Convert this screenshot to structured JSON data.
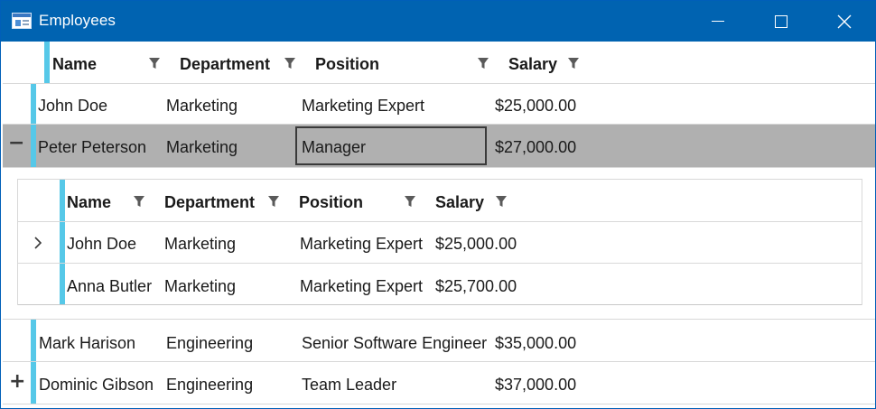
{
  "window": {
    "title": "Employees",
    "controls": {
      "minimize": "minimize",
      "maximize": "maximize",
      "close": "close"
    }
  },
  "main_grid": {
    "columns": [
      "Name",
      "Department",
      "Position",
      "Salary"
    ],
    "rows": [
      {
        "name": "John Doe",
        "department": "Marketing",
        "position": "Marketing Expert",
        "salary": "$25,000.00",
        "expander": ""
      },
      {
        "name": "Peter Peterson",
        "department": "Marketing",
        "position": "Manager",
        "salary": "$27,000.00",
        "expander": "−",
        "selected": true
      },
      {
        "name": "Mark Harison",
        "department": "Engineering",
        "position": "Senior Software Engineer",
        "salary": "$35,000.00",
        "expander": ""
      },
      {
        "name": "Dominic Gibson",
        "department": "Engineering",
        "position": "Team Leader",
        "salary": "$37,000.00",
        "expander": "+"
      }
    ]
  },
  "nested_grid": {
    "columns": [
      "Name",
      "Department",
      "Position",
      "Salary"
    ],
    "rows": [
      {
        "name": "John Doe",
        "department": "Marketing",
        "position": "Marketing Expert",
        "salary": "$25,000.00",
        "expander": "›"
      },
      {
        "name": "Anna Butler",
        "department": "Marketing",
        "position": "Marketing Expert",
        "salary": "$25,700.00",
        "expander": ""
      }
    ]
  },
  "colors": {
    "title_bar": "#0063b1",
    "row_indicator": "#56c8e8",
    "selected_row": "#b0b0b0",
    "grid_lines": "#d8d8d8"
  }
}
